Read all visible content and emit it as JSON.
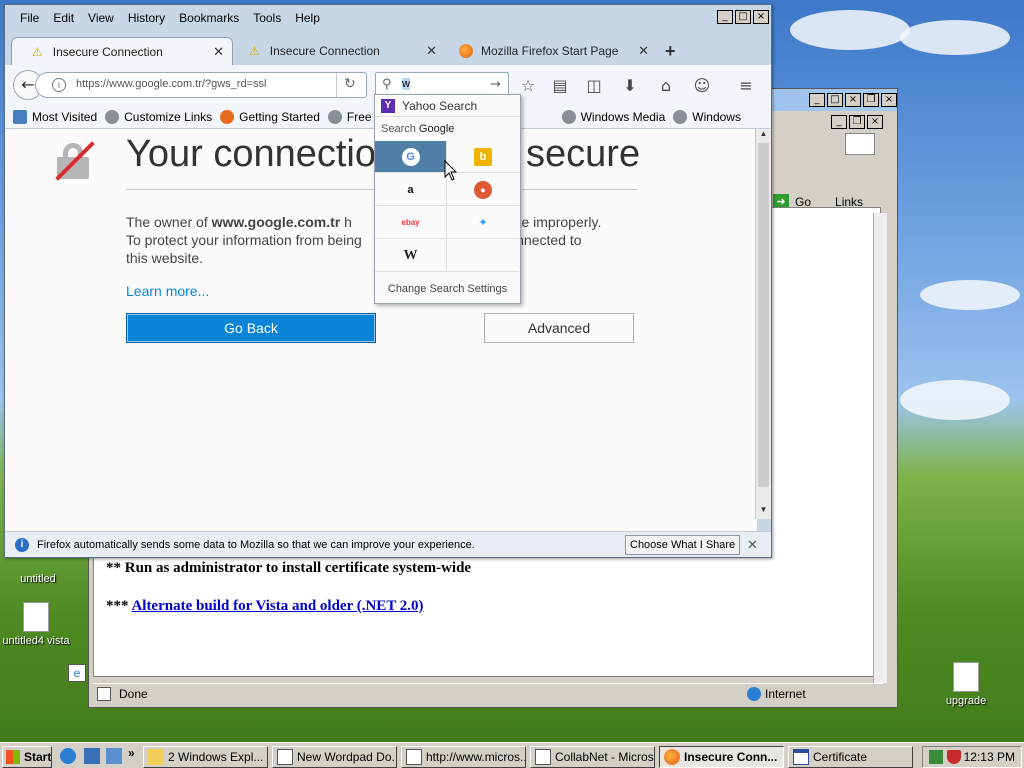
{
  "desktop": {
    "icons": [
      {
        "label": "untitled"
      },
      {
        "label": "untitled4 vista"
      },
      {
        "label": "upgrade"
      }
    ]
  },
  "ie_window": {
    "toolbar": {
      "go_label": "Go",
      "links_label": "Links"
    },
    "content": {
      "line1": "** Run as administrator to install certificate system-wide",
      "line2_prefix": "*** ",
      "line2_link": "Alternate build for Vista and older (.NET 2.0)"
    },
    "status": {
      "text": "Done",
      "zone": "Internet"
    }
  },
  "firefox": {
    "menu": [
      "File",
      "Edit",
      "View",
      "History",
      "Bookmarks",
      "Tools",
      "Help"
    ],
    "tabs": [
      {
        "label": "Insecure Connection"
      },
      {
        "label": "Insecure Connection"
      },
      {
        "label": "Mozilla Firefox Start Page"
      }
    ],
    "url": "https://www.google.com.tr/?gws_rd=ssl",
    "search_value": "w",
    "bookmarks": [
      "Most Visited",
      "Customize Links",
      "Getting Started",
      "Free Hotm",
      "Windows Media",
      "Windows"
    ],
    "page": {
      "title": "Your connection is not secure",
      "title_left": "Your connectio",
      "title_right": "secure",
      "body_a": "The owner of ",
      "body_domain": "www.google.com.tr",
      "body_b": " h",
      "body_c": "ebsite improperly.",
      "body_d": "To protect your information from being",
      "body_e": "ot connected to",
      "body_f": "this website.",
      "learn_more": "Learn more...",
      "go_back": "Go Back",
      "advanced": "Advanced"
    },
    "notification": {
      "text": "Firefox automatically sends some data to Mozilla so that we can improve your experience.",
      "button": "Choose What I Share"
    },
    "search_dropdown": {
      "suggestion": "Yahoo Search",
      "search_with_prefix": "Search ",
      "search_with_engine": "Google",
      "settings": "Change Search Settings"
    }
  },
  "taskbar": {
    "start": "Start",
    "buttons": [
      "2 Windows Expl...",
      "New Wordpad Do...",
      "http://www.micros...",
      "CollabNet - Micros...",
      "Insecure Conn...",
      "Certificate"
    ],
    "clock": "12:13 PM"
  },
  "colors": {
    "accent": "#0a84d6",
    "insecure_red": "#d92d2d",
    "selected_engine": "#4f7fa6"
  }
}
